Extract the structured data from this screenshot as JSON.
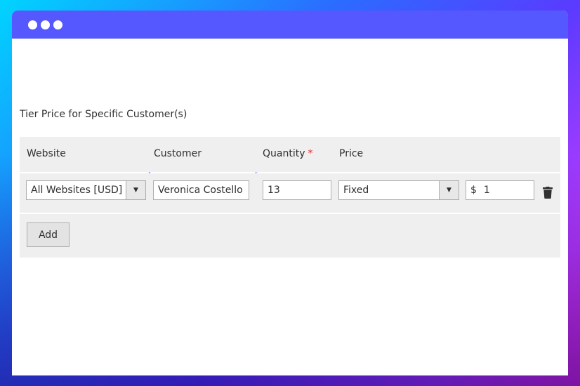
{
  "section": {
    "title": "Tier Price for Specific Customer(s)"
  },
  "table": {
    "headers": {
      "website": "Website",
      "customer": "Customer",
      "quantity": "Quantity",
      "quantity_required": "*",
      "price": "Price"
    },
    "row": {
      "website": "All Websites [USD]",
      "customer": "Veronica Costello",
      "quantity": "13",
      "price_type": "Fixed",
      "currency_symbol": "$",
      "price": "1"
    },
    "add_label": "Add"
  },
  "colors": {
    "titlebar": "#5558ff",
    "accent_focus": "#5e67ff",
    "required": "#e22626"
  },
  "icons": {
    "delete": "trash-icon",
    "dropdown": "chevron-down-icon"
  }
}
